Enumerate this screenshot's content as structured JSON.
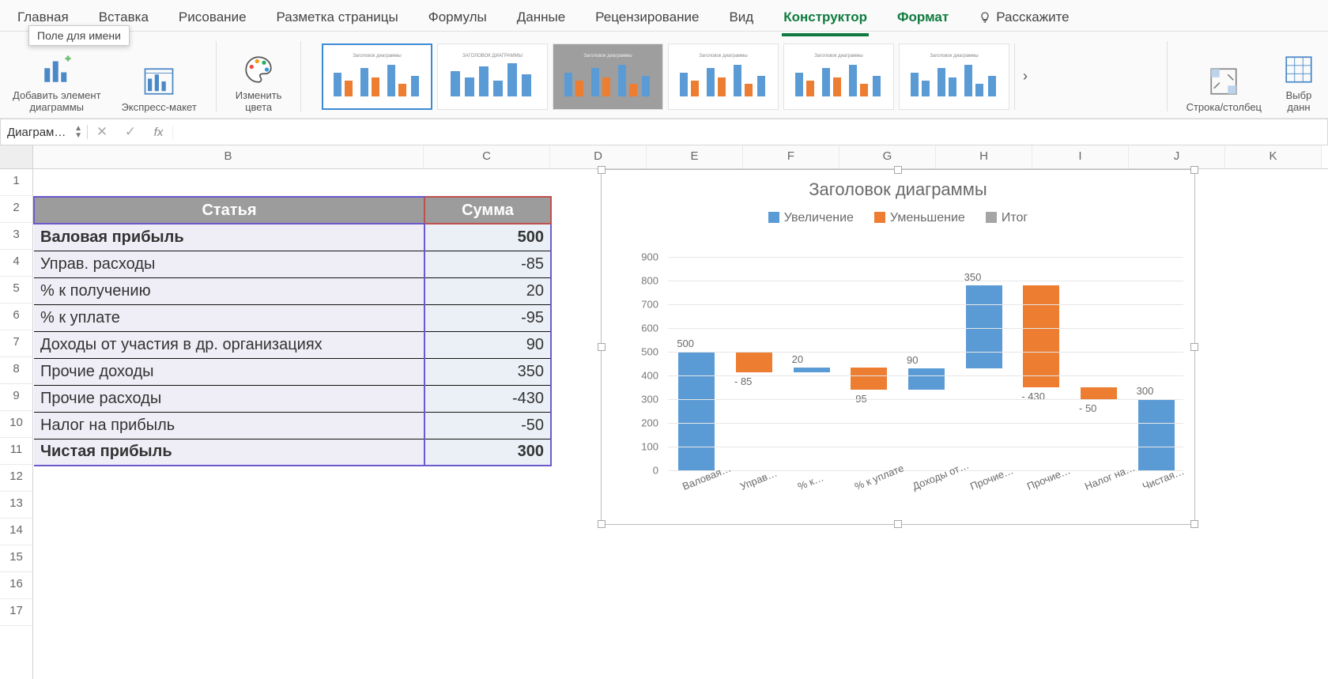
{
  "tabs": [
    "Главная",
    "Вставка",
    "Рисование",
    "Разметка страницы",
    "Формулы",
    "Данные",
    "Рецензирование",
    "Вид",
    "Конструктор",
    "Формат",
    "Расскажите"
  ],
  "active_tab_index": 8,
  "green_tabs": [
    8,
    9
  ],
  "ribbon": {
    "add_element": "Добавить элемент\nдиаграммы",
    "quick_layout": "Экспресс-макет",
    "change_colors": "Изменить\nцвета",
    "row_col": "Строка/столбец",
    "select_data": "Выбр\nданн",
    "gallery_title": "Заголовок диаграммы",
    "gallery_subtitle": "ЗАГОЛОВОК ДИАГРАММЫ"
  },
  "namebox": "Диаграм…",
  "tooltip": "Поле для имени",
  "fx": "fx",
  "columns": [
    "B",
    "C",
    "D",
    "E",
    "F",
    "G",
    "H",
    "I",
    "J",
    "K"
  ],
  "rows": [
    1,
    2,
    3,
    4,
    5,
    6,
    7,
    8,
    9,
    10,
    11,
    12,
    13,
    14,
    15,
    16,
    17
  ],
  "table": {
    "headers": [
      "Статья",
      "Сумма"
    ],
    "rows": [
      {
        "article": "Валовая прибыль",
        "sum": "500",
        "bold": true
      },
      {
        "article": "Управ. расходы",
        "sum": "-85"
      },
      {
        "article": "% к получению",
        "sum": "20"
      },
      {
        "article": "% к уплате",
        "sum": "-95"
      },
      {
        "article": "Доходы от участия в др. организациях",
        "sum": "90"
      },
      {
        "article": "Прочие доходы",
        "sum": "350"
      },
      {
        "article": "Прочие расходы",
        "sum": "-430"
      },
      {
        "article": "Налог на прибыль",
        "sum": "-50"
      },
      {
        "article": "Чистая прибыль",
        "sum": "300",
        "bold": true
      }
    ]
  },
  "chart_data": {
    "type": "bar",
    "title": "Заголовок диаграммы",
    "legend": [
      {
        "name": "Увеличение",
        "color": "#5b9bd5"
      },
      {
        "name": "Уменьшение",
        "color": "#ed7d31"
      },
      {
        "name": "Итог",
        "color": "#a5a5a5"
      }
    ],
    "ylim": [
      0,
      900
    ],
    "yticks": [
      0,
      100,
      200,
      300,
      400,
      500,
      600,
      700,
      800,
      900
    ],
    "categories": [
      "Валовая…",
      "Управ…",
      "% к…",
      "% к уплате",
      "Доходы от…",
      "Прочие…",
      "Прочие…",
      "Налог на…",
      "Чистая…"
    ],
    "bars": [
      {
        "label": "500",
        "bottom": 0,
        "top": 500,
        "series": "increase"
      },
      {
        "label": "- 85",
        "bottom": 415,
        "top": 500,
        "series": "decrease"
      },
      {
        "label": "20",
        "bottom": 415,
        "top": 435,
        "series": "increase"
      },
      {
        "label": "- 95",
        "bottom": 340,
        "top": 435,
        "series": "decrease"
      },
      {
        "label": "90",
        "bottom": 340,
        "top": 430,
        "series": "increase"
      },
      {
        "label": "350",
        "bottom": 430,
        "top": 780,
        "series": "increase"
      },
      {
        "label": "- 430",
        "bottom": 350,
        "top": 780,
        "series": "decrease"
      },
      {
        "label": "- 50",
        "bottom": 300,
        "top": 350,
        "series": "decrease"
      },
      {
        "label": "300",
        "bottom": 0,
        "top": 300,
        "series": "total"
      }
    ],
    "last_is_total": true
  }
}
